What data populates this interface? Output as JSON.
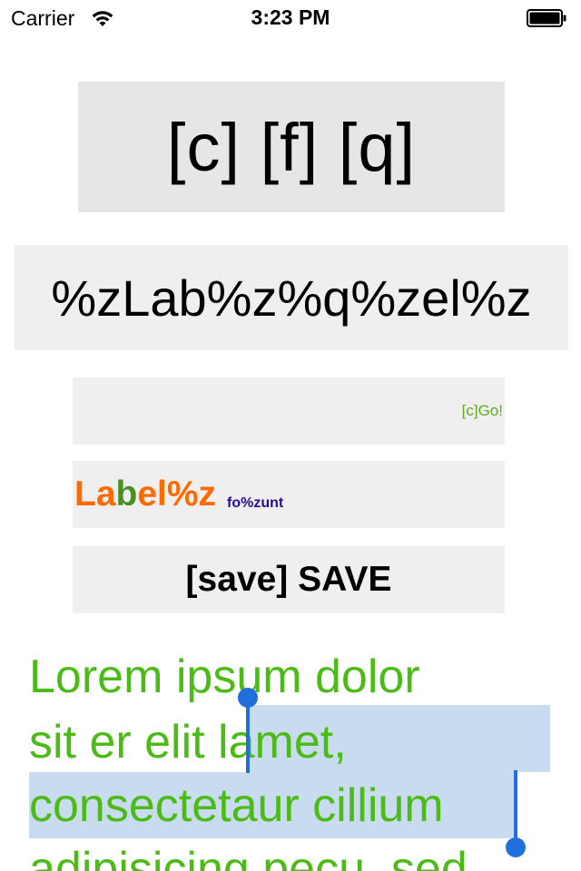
{
  "status_bar": {
    "carrier": "Carrier",
    "time": "3:23 PM",
    "wifi_icon": "wifi-icon",
    "battery_icon": "battery-icon"
  },
  "labels": {
    "top_label": "[c] [f] [q]",
    "second_label": "%zLab%z%q%zel%z",
    "go_button": "[c]Go!",
    "styled_label": {
      "parts": [
        {
          "text": "La",
          "color": "#ff6a00"
        },
        {
          "text": "b",
          "color": "#4a8f22"
        },
        {
          "text": "el%z",
          "color": "#ff6a00"
        }
      ],
      "suffix": "fo%zunt",
      "suffix_color": "#2b0b8f"
    },
    "save_button": "[save] SAVE"
  },
  "text_view": {
    "lines": [
      "Lorem ipsum dolor",
      "sit er elit lamet,",
      "consectetaur cillium",
      "adipisicing pecu, sed"
    ],
    "text_color": "#4cbb17",
    "selection_color": "#c9dbee",
    "handle_color": "#1f6fdc"
  }
}
